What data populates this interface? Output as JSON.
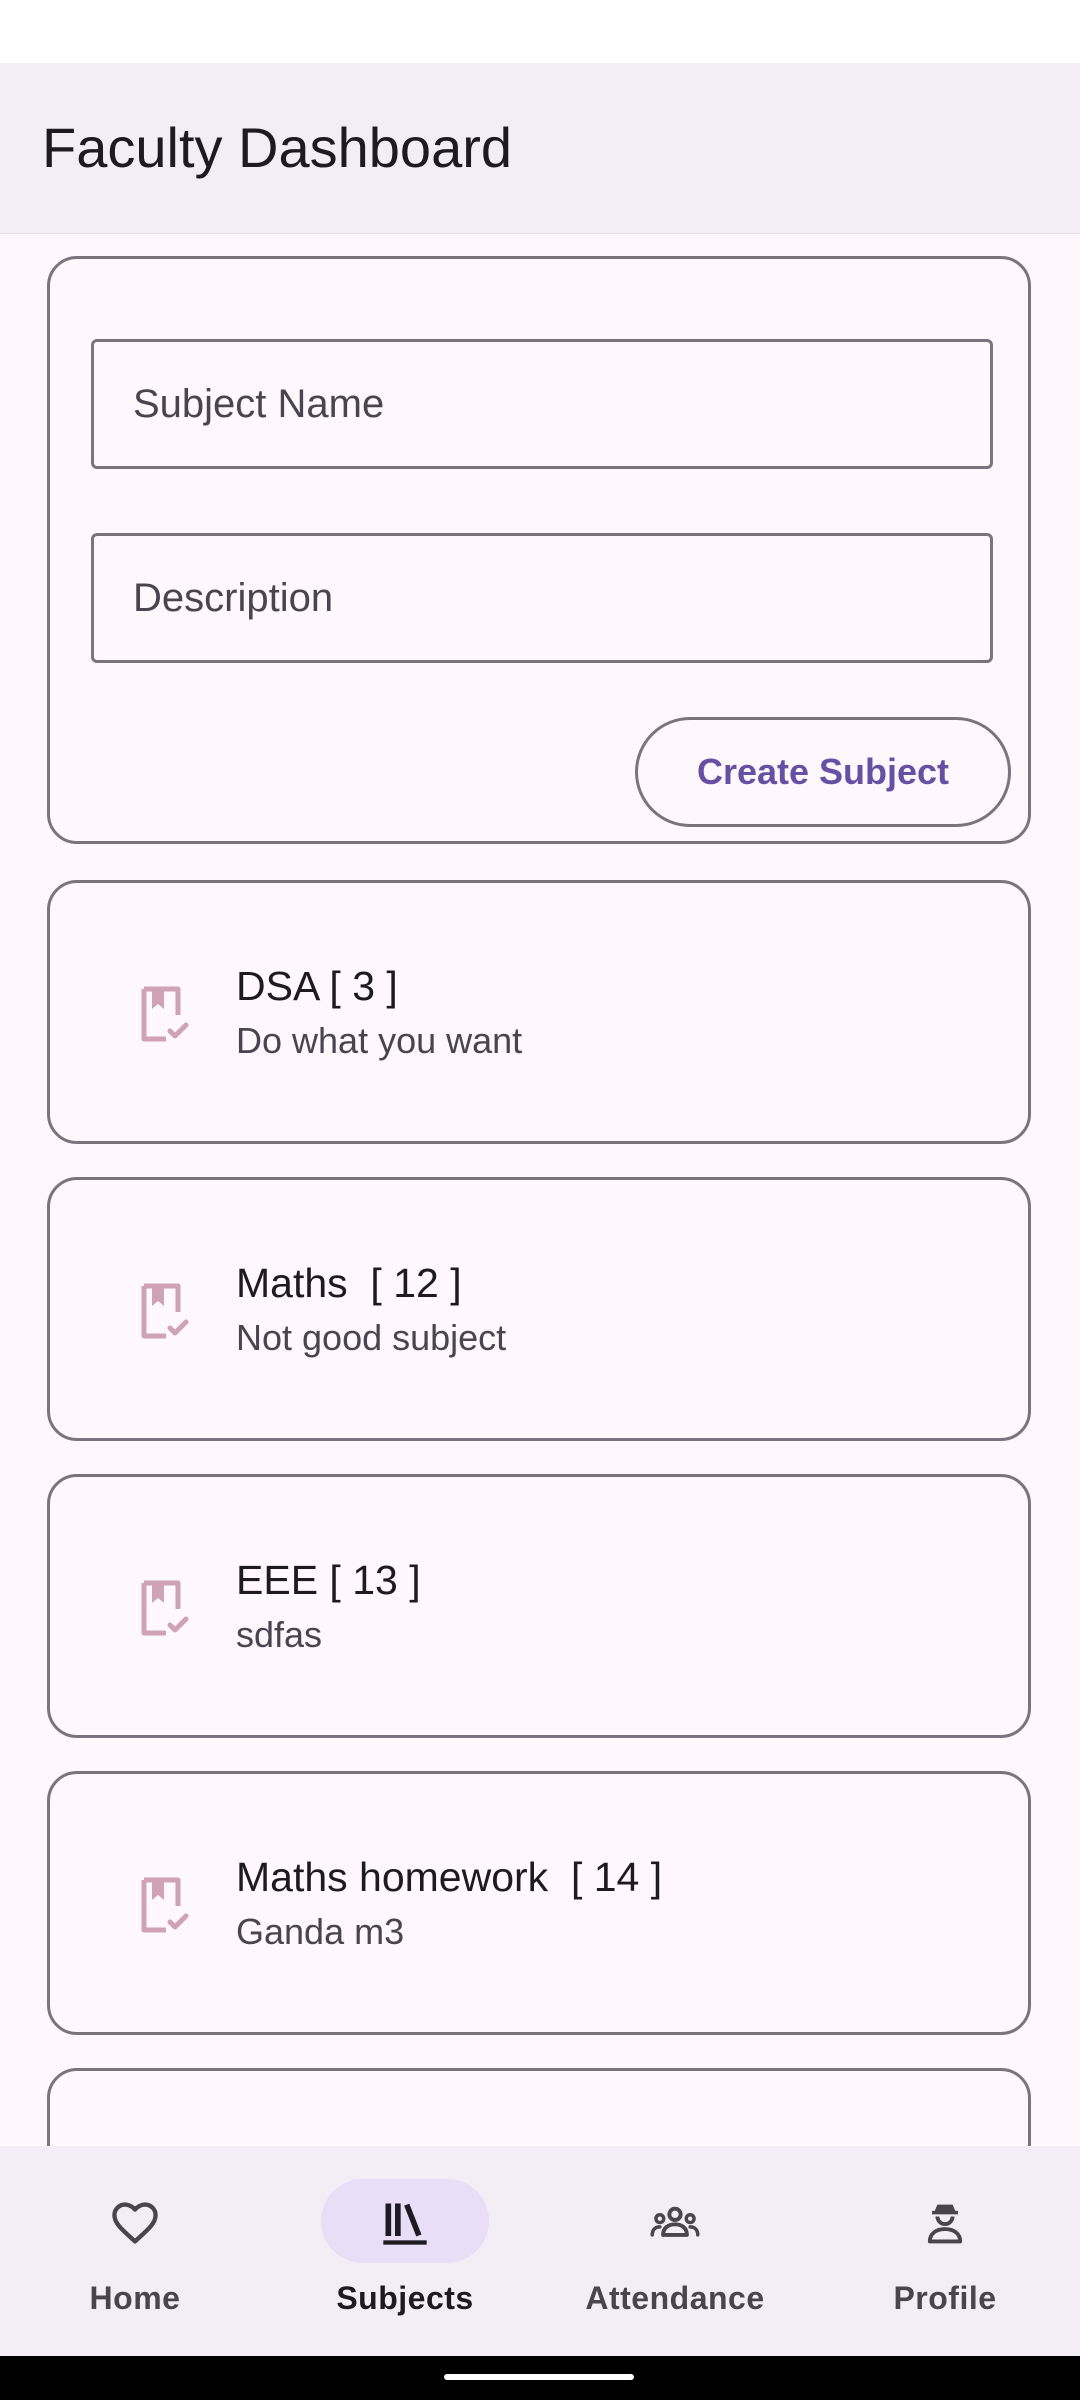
{
  "app_bar": {
    "title": "Faculty Dashboard"
  },
  "form": {
    "subject_name_placeholder": "Subject Name",
    "description_placeholder": "Description",
    "create_button_label": "Create Subject"
  },
  "subjects": [
    {
      "title": "DSA [ 3 ]",
      "description": "Do what you want",
      "icon": "book-check-icon"
    },
    {
      "title": "Maths  [ 12 ]",
      "description": "Not good subject",
      "icon": "book-check-icon"
    },
    {
      "title": "EEE [ 13 ]",
      "description": "sdfas",
      "icon": "book-check-icon"
    },
    {
      "title": "Maths homework  [ 14 ]",
      "description": "Ganda m3",
      "icon": "book-check-icon"
    }
  ],
  "bottom_nav": {
    "items": [
      {
        "label": "Home",
        "icon": "heart-icon"
      },
      {
        "label": "Subjects",
        "icon": "library-icon",
        "selected": true
      },
      {
        "label": "Attendance",
        "icon": "groups-icon"
      },
      {
        "label": "Profile",
        "icon": "person-icon"
      }
    ]
  },
  "colors": {
    "primary": "#6750A4",
    "icon_accent": "#D0A3B4",
    "outline": "#79747E",
    "surface": "#FEF7FB",
    "container": "#F3EDF5",
    "selected_indicator": "#E8DEF8"
  }
}
